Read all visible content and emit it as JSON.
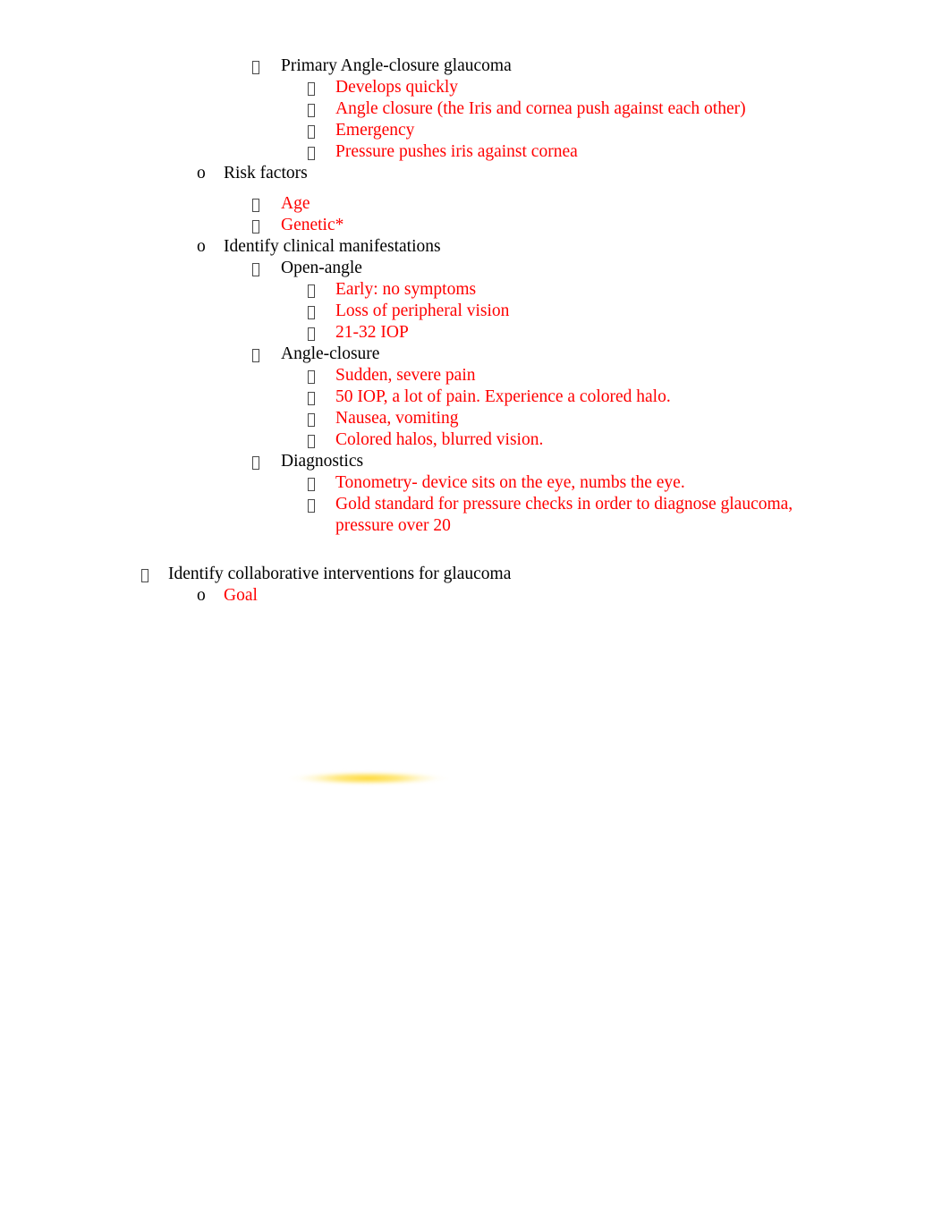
{
  "document": {
    "type": "outline-notes",
    "topic": "Glaucoma study notes",
    "colors": {
      "body_text": "#000000",
      "answer_text": "#FF0000",
      "highlight_artifact": "#FFD629",
      "page_background": "#FFFFFF"
    },
    "markers": {
      "tofu_box": "missing-glyph-box",
      "letter_o": "o"
    }
  },
  "outline": [
    {
      "id": "primary-angle-closure-glaucoma",
      "level": 3,
      "marker": "tofu",
      "color": "black",
      "text": "Primary Angle-closure glaucoma"
    },
    {
      "id": "develops-quickly",
      "level": 4,
      "marker": "tofu",
      "color": "red",
      "text": "Develops quickly"
    },
    {
      "id": "angle-closure-iris-cornea",
      "level": 4,
      "marker": "tofu",
      "color": "red",
      "text": "Angle closure (the Iris and cornea push against each other)"
    },
    {
      "id": "emergency",
      "level": 4,
      "marker": "tofu",
      "color": "red",
      "text": "Emergency"
    },
    {
      "id": "pressure-pushes-iris",
      "level": 4,
      "marker": "tofu",
      "color": "red",
      "text": "Pressure pushes iris against cornea"
    },
    {
      "id": "risk-factors",
      "level": 2,
      "marker": "o",
      "color": "black",
      "text": "Risk factors"
    },
    {
      "id": "age",
      "level": 3,
      "marker": "tofu",
      "color": "red",
      "text": "Age"
    },
    {
      "id": "genetic",
      "level": 3,
      "marker": "tofu",
      "color": "red",
      "text": "Genetic*"
    },
    {
      "id": "identify-clinical-manifestations",
      "level": 2,
      "marker": "o",
      "color": "black",
      "text": "Identify clinical manifestations"
    },
    {
      "id": "open-angle",
      "level": 3,
      "marker": "tofu",
      "color": "black",
      "text": "Open-angle"
    },
    {
      "id": "early-no-symptoms",
      "level": 4,
      "marker": "tofu",
      "color": "red",
      "text": "Early: no symptoms"
    },
    {
      "id": "loss-of-peripheral-vision",
      "level": 4,
      "marker": "tofu",
      "color": "red",
      "text": "Loss of peripheral vision"
    },
    {
      "id": "21-32-iop",
      "level": 4,
      "marker": "tofu",
      "color": "red",
      "text": "21-32 IOP"
    },
    {
      "id": "angle-closure",
      "level": 3,
      "marker": "tofu",
      "color": "black",
      "text": "Angle-closure"
    },
    {
      "id": "sudden-severe-pain",
      "level": 4,
      "marker": "tofu",
      "color": "red",
      "text": "Sudden, severe pain"
    },
    {
      "id": "50-iop-colored-halo",
      "level": 4,
      "marker": "tofu",
      "color": "red",
      "text": "50 IOP, a lot of pain. Experience a colored halo."
    },
    {
      "id": "nausea-vomiting",
      "level": 4,
      "marker": "tofu",
      "color": "red",
      "text": "Nausea, vomiting"
    },
    {
      "id": "colored-halos-blurred-vision",
      "level": 4,
      "marker": "tofu",
      "color": "red",
      "text": "Colored halos, blurred vision."
    },
    {
      "id": "diagnostics",
      "level": 3,
      "marker": "tofu",
      "color": "black",
      "text": "Diagnostics"
    },
    {
      "id": "tonometry",
      "level": 4,
      "marker": "tofu",
      "color": "red",
      "text": "Tonometry- device sits on the eye, numbs the eye."
    },
    {
      "id": "gold-standard-pressure-checks",
      "level": 4,
      "marker": "tofu",
      "color": "red",
      "text": "Gold standard for pressure checks in order to diagnose glaucoma, pressure over 20"
    },
    {
      "id": "identify-collaborative-interventions",
      "level": 1,
      "marker": "tofu",
      "color": "black",
      "text": "Identify collaborative interventions for glaucoma"
    },
    {
      "id": "goal",
      "level": 2,
      "marker": "o",
      "color": "red",
      "text": "Goal"
    }
  ]
}
